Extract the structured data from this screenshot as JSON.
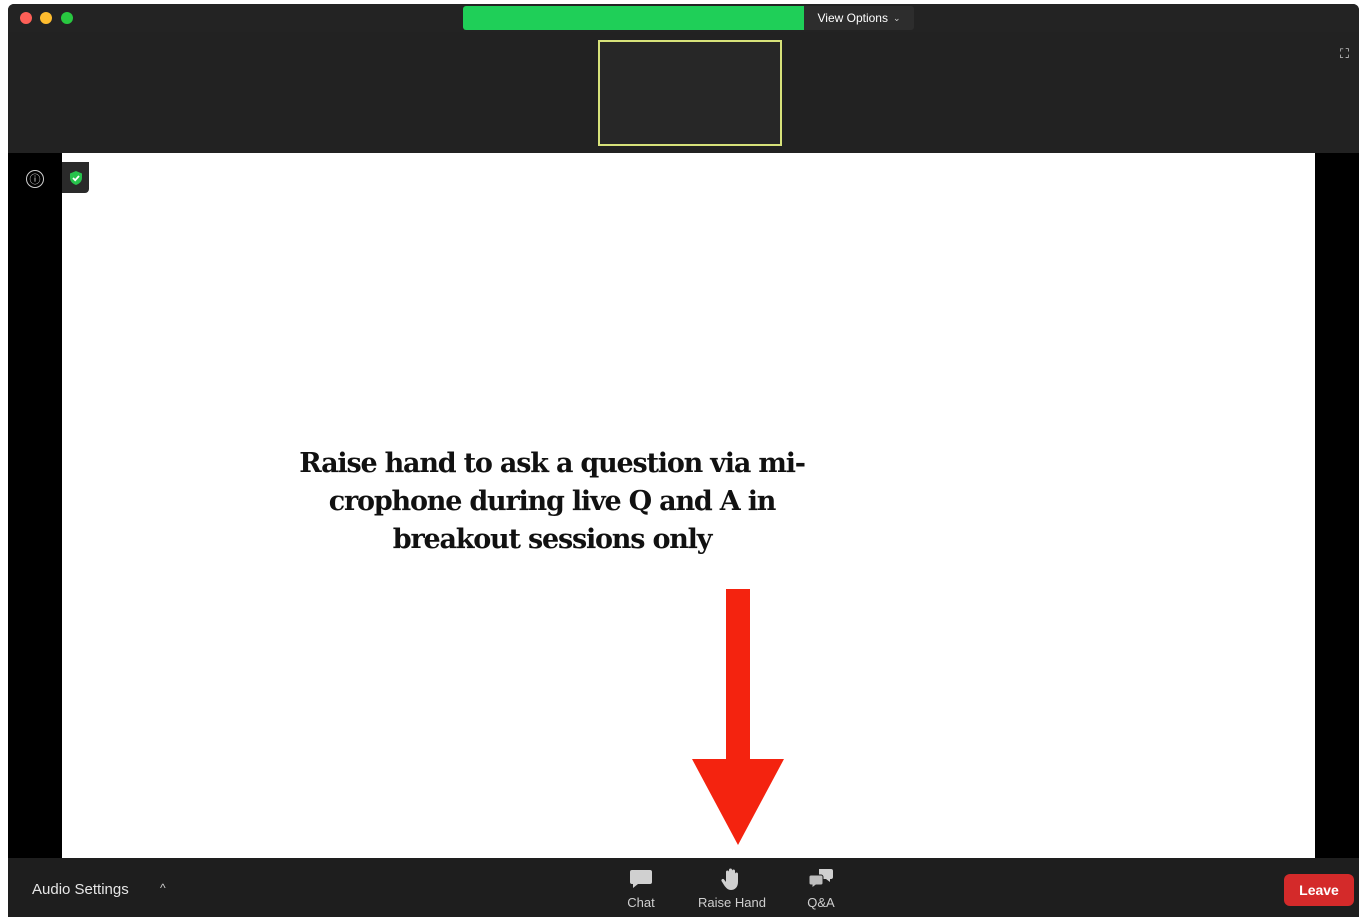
{
  "titlebar": {
    "view_options_label": "View Options",
    "share_color": "#1fcf58"
  },
  "stage": {
    "caption_lines": [
      "Raise hand to ask a question via mi-",
      "crophone during live Q and A in",
      "breakout sessions only"
    ],
    "arrow_color": "#f4230f",
    "info_icon": "ⓘ"
  },
  "toolbar": {
    "audio_settings_label": "Audio Settings",
    "caret": "^",
    "chat_label": "Chat",
    "raise_hand_label": "Raise Hand",
    "qa_label": "Q&A",
    "leave_label": "Leave",
    "leave_color": "#d42a2a"
  },
  "icons": {
    "close": "close-icon",
    "minimize": "minimize-icon",
    "maximize": "maximize-icon",
    "fullscreen": "fullscreen-icon",
    "info": "info-icon",
    "shield": "shield-check-icon",
    "chat": "chat-bubble-icon",
    "hand": "raise-hand-icon",
    "qa": "qa-bubbles-icon"
  }
}
